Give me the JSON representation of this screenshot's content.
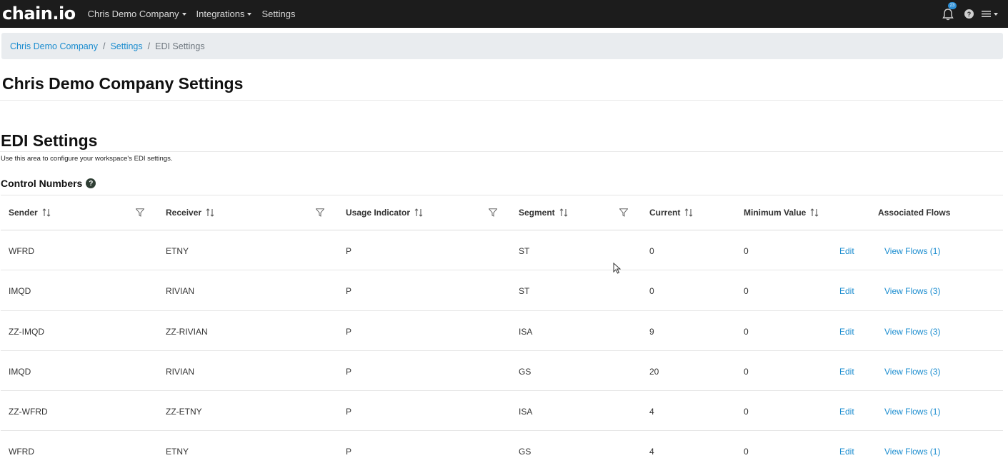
{
  "nav": {
    "logo": "chain.io",
    "menu": [
      {
        "label": "Chris Demo Company",
        "dropdown": true
      },
      {
        "label": "Integrations",
        "dropdown": true
      },
      {
        "label": "Settings",
        "dropdown": false
      }
    ],
    "notification_count": "23",
    "help_glyph": "?"
  },
  "breadcrumb": {
    "items": [
      "Chris Demo Company",
      "Settings"
    ],
    "separator": "/",
    "current": "EDI Settings"
  },
  "page_title": "Chris Demo Company Settings",
  "section": {
    "title": "EDI Settings",
    "description": "Use this area to configure your workspace's EDI settings."
  },
  "control_numbers": {
    "title": "Control Numbers",
    "help_glyph": "?",
    "columns": [
      "Sender",
      "Receiver",
      "Usage Indicator",
      "Segment",
      "Current",
      "Minimum Value",
      "Associated Flows"
    ],
    "rows": [
      {
        "sender": "WFRD",
        "receiver": "ETNY",
        "usage": "P",
        "segment": "ST",
        "current": "0",
        "minimum": "0",
        "edit": "Edit",
        "flows": "View Flows (1)"
      },
      {
        "sender": "IMQD",
        "receiver": "RIVIAN",
        "usage": "P",
        "segment": "ST",
        "current": "0",
        "minimum": "0",
        "edit": "Edit",
        "flows": "View Flows (3)"
      },
      {
        "sender": "ZZ-IMQD",
        "receiver": "ZZ-RIVIAN",
        "usage": "P",
        "segment": "ISA",
        "current": "9",
        "minimum": "0",
        "edit": "Edit",
        "flows": "View Flows (3)"
      },
      {
        "sender": "IMQD",
        "receiver": "RIVIAN",
        "usage": "P",
        "segment": "GS",
        "current": "20",
        "minimum": "0",
        "edit": "Edit",
        "flows": "View Flows (3)"
      },
      {
        "sender": "ZZ-WFRD",
        "receiver": "ZZ-ETNY",
        "usage": "P",
        "segment": "ISA",
        "current": "4",
        "minimum": "0",
        "edit": "Edit",
        "flows": "View Flows (1)"
      },
      {
        "sender": "WFRD",
        "receiver": "ETNY",
        "usage": "P",
        "segment": "GS",
        "current": "4",
        "minimum": "0",
        "edit": "Edit",
        "flows": "View Flows (1)"
      }
    ]
  },
  "colors": {
    "navbar_bg": "#1c1c1c",
    "link": "#1a8ccf",
    "breadcrumb_bg": "#e9ecef",
    "badge": "#2d8fd6"
  }
}
